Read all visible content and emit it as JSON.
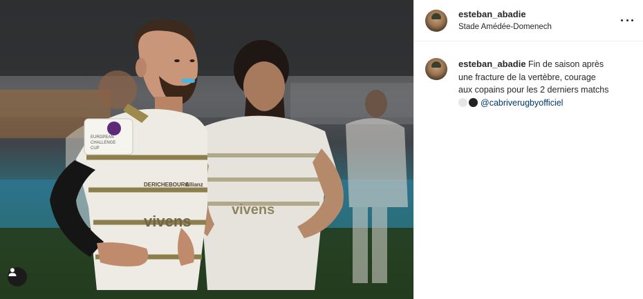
{
  "post": {
    "author": {
      "username": "esteban_abadie",
      "location": "Stade Amédée-Domenech"
    },
    "caption": {
      "username": "esteban_abadie",
      "lines": [
        "Fin de saison après",
        "une fracture de la vertèbre, courage",
        "aux copains pour les 2 derniers matchs"
      ],
      "mention": "@cabriverugbyofficiel"
    },
    "photo": {
      "sponsor_texts": {
        "badge_line1": "EUROPEAN",
        "badge_line2": "CHALLENGE",
        "badge_line3": "CUP",
        "deriche": "DERICHEBOURG",
        "vivens": "vivens",
        "vivens_back": "vivens",
        "allianz": "Allianz"
      }
    },
    "icons": {
      "more": "more-options-icon",
      "user_tags": "person-icon",
      "caption_emoji": "two-dots-emoji"
    },
    "colors": {
      "mention": "#00376b",
      "text": "#262626",
      "divider": "#efefef"
    }
  }
}
